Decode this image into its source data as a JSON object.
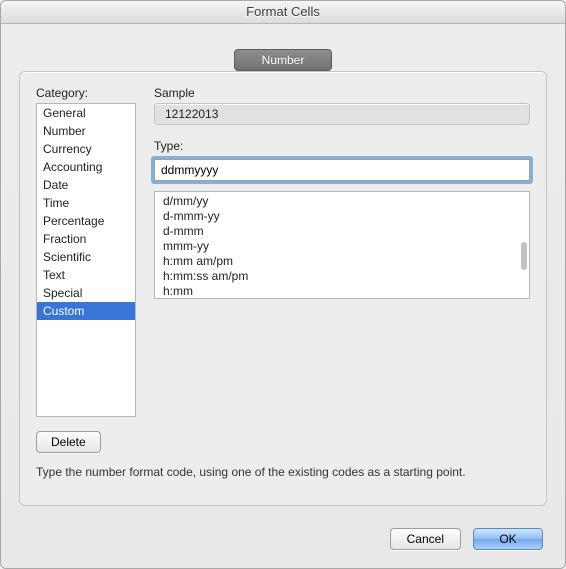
{
  "dialog": {
    "title": "Format Cells"
  },
  "tabs": {
    "active": "Number"
  },
  "category": {
    "label": "Category:",
    "items": [
      "General",
      "Number",
      "Currency",
      "Accounting",
      "Date",
      "Time",
      "Percentage",
      "Fraction",
      "Scientific",
      "Text",
      "Special",
      "Custom"
    ],
    "selected_index": 11
  },
  "sample": {
    "label": "Sample",
    "value": "12122013"
  },
  "type": {
    "label": "Type:",
    "value": "ddmmyyyy"
  },
  "format_list": [
    "d/mm/yy",
    "d-mmm-yy",
    "d-mmm",
    "mmm-yy",
    "h:mm am/pm",
    "h:mm:ss am/pm",
    "h:mm"
  ],
  "buttons": {
    "delete": "Delete",
    "cancel": "Cancel",
    "ok": "OK"
  },
  "hint": "Type the number format code, using one of the existing codes as a starting point."
}
